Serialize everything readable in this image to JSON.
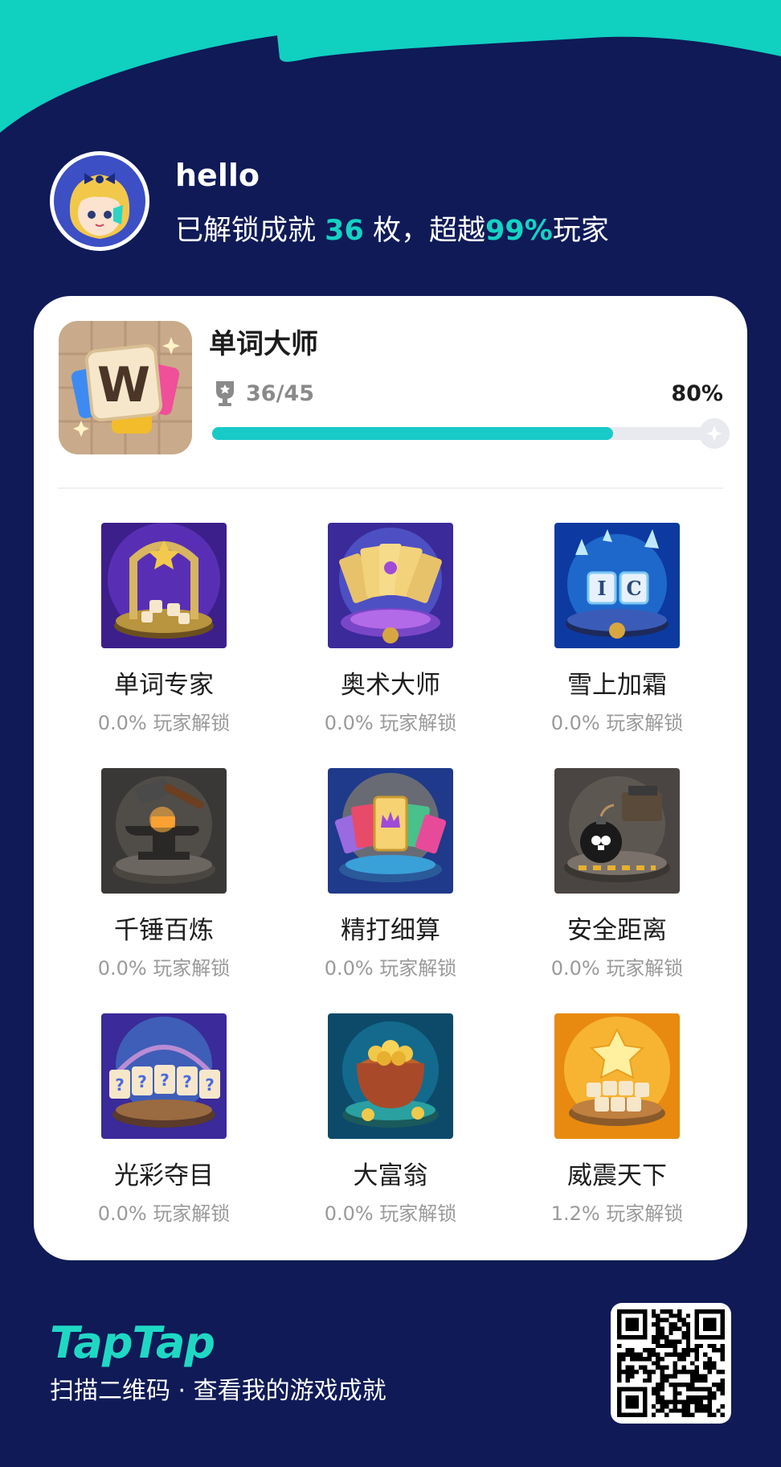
{
  "user": {
    "name": "hello",
    "summary_prefix": "已解锁成就",
    "unlocked_count": "36",
    "summary_mid": "枚，超越",
    "percentile": "99%",
    "summary_suffix": "玩家"
  },
  "game": {
    "title": "单词大师",
    "progress_text": "36/45",
    "progress_percent": "80%",
    "progress_fraction": 0.8,
    "icon": "word-tile-w-icon"
  },
  "achievements": [
    {
      "name": "单词专家",
      "rate": "0.0% 玩家解锁",
      "icon": "word-altar-icon"
    },
    {
      "name": "奥术大师",
      "rate": "0.0% 玩家解锁",
      "icon": "arcane-cards-icon"
    },
    {
      "name": "雪上加霜",
      "rate": "0.0% 玩家解锁",
      "icon": "ice-tiles-icon"
    },
    {
      "name": "千锤百炼",
      "rate": "0.0% 玩家解锁",
      "icon": "anvil-hammer-icon"
    },
    {
      "name": "精打细算",
      "rate": "0.0% 玩家解锁",
      "icon": "crown-cards-icon"
    },
    {
      "name": "安全距离",
      "rate": "0.0% 玩家解锁",
      "icon": "bomb-icon"
    },
    {
      "name": "光彩夺目",
      "rate": "0.0% 玩家解锁",
      "icon": "mystery-cards-icon"
    },
    {
      "name": "大富翁",
      "rate": "0.0% 玩家解锁",
      "icon": "treasure-pouch-icon"
    },
    {
      "name": "威震天下",
      "rate": "1.2% 玩家解锁",
      "icon": "star-letters-icon"
    }
  ],
  "footer": {
    "brand": "TapTap",
    "caption": "扫描二维码 · 查看我的游戏成就"
  },
  "colors": {
    "background": "#0f1a57",
    "accent": "#15d2c3",
    "wave": "#10d0c0"
  }
}
